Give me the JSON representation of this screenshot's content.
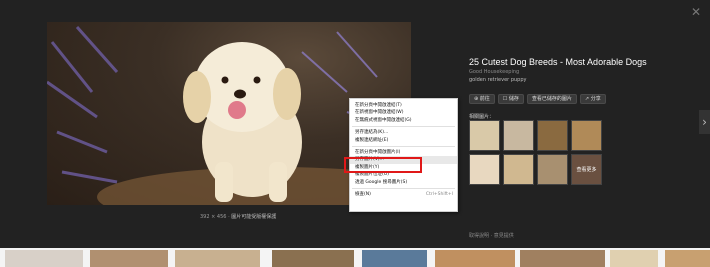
{
  "viewer": {
    "close_icon": "close-icon",
    "image_size": "392 × 456",
    "image_link": "圖片可能受版權保護",
    "next_icon": "chevron-right-icon"
  },
  "info": {
    "title": "25 Cutest Dog Breeds - Most Adorable Dogs",
    "source": "Good Housekeeping",
    "description": "golden retriever puppy",
    "actions": [
      "前往",
      "儲存",
      "查看已儲存的圖片",
      "分享"
    ]
  },
  "related": {
    "label": "相關圖片：",
    "view_more": "查看更多",
    "thumb_colors": [
      "#d9c9a8",
      "#c8b8a0",
      "#8a6a40",
      "#b08a58",
      "#e8d8c0",
      "#d0b890",
      "#a89070",
      "#6a5040"
    ]
  },
  "footer": {
    "text": "取得說明 · 意見提供"
  },
  "context_menu": {
    "items": [
      {
        "label": "在新分頁中開啟連結(T)",
        "shortcut": ""
      },
      {
        "label": "在新視窗中開啟連結(W)",
        "shortcut": ""
      },
      {
        "label": "在無痕式視窗中開啟連結(G)",
        "shortcut": ""
      },
      {
        "label": "---"
      },
      {
        "label": "另存連結為(K)...",
        "shortcut": ""
      },
      {
        "label": "複製連結網址(E)",
        "shortcut": ""
      },
      {
        "label": "---"
      },
      {
        "label": "在新分頁中開啟圖片(I)",
        "shortcut": ""
      },
      {
        "label": "另存圖片(V)...",
        "shortcut": ""
      },
      {
        "label": "複製圖片(Y)",
        "shortcut": ""
      },
      {
        "label": "複製圖片位址(O)",
        "shortcut": ""
      },
      {
        "label": "透過 Google 搜尋圖片(S)",
        "shortcut": ""
      },
      {
        "label": "---"
      },
      {
        "label": "檢查(N)",
        "shortcut": "Ctrl+Shift+I"
      }
    ],
    "highlighted_index": 8,
    "highlight_color": "#e01818"
  },
  "strip": {
    "thumb_colors": [
      "#d8d0c8",
      "#b09070",
      "#c8b090",
      "#8a7050",
      "#5a7a9a",
      "#c09060",
      "#a08060",
      "#e0d0b0",
      "#c8a070"
    ]
  }
}
